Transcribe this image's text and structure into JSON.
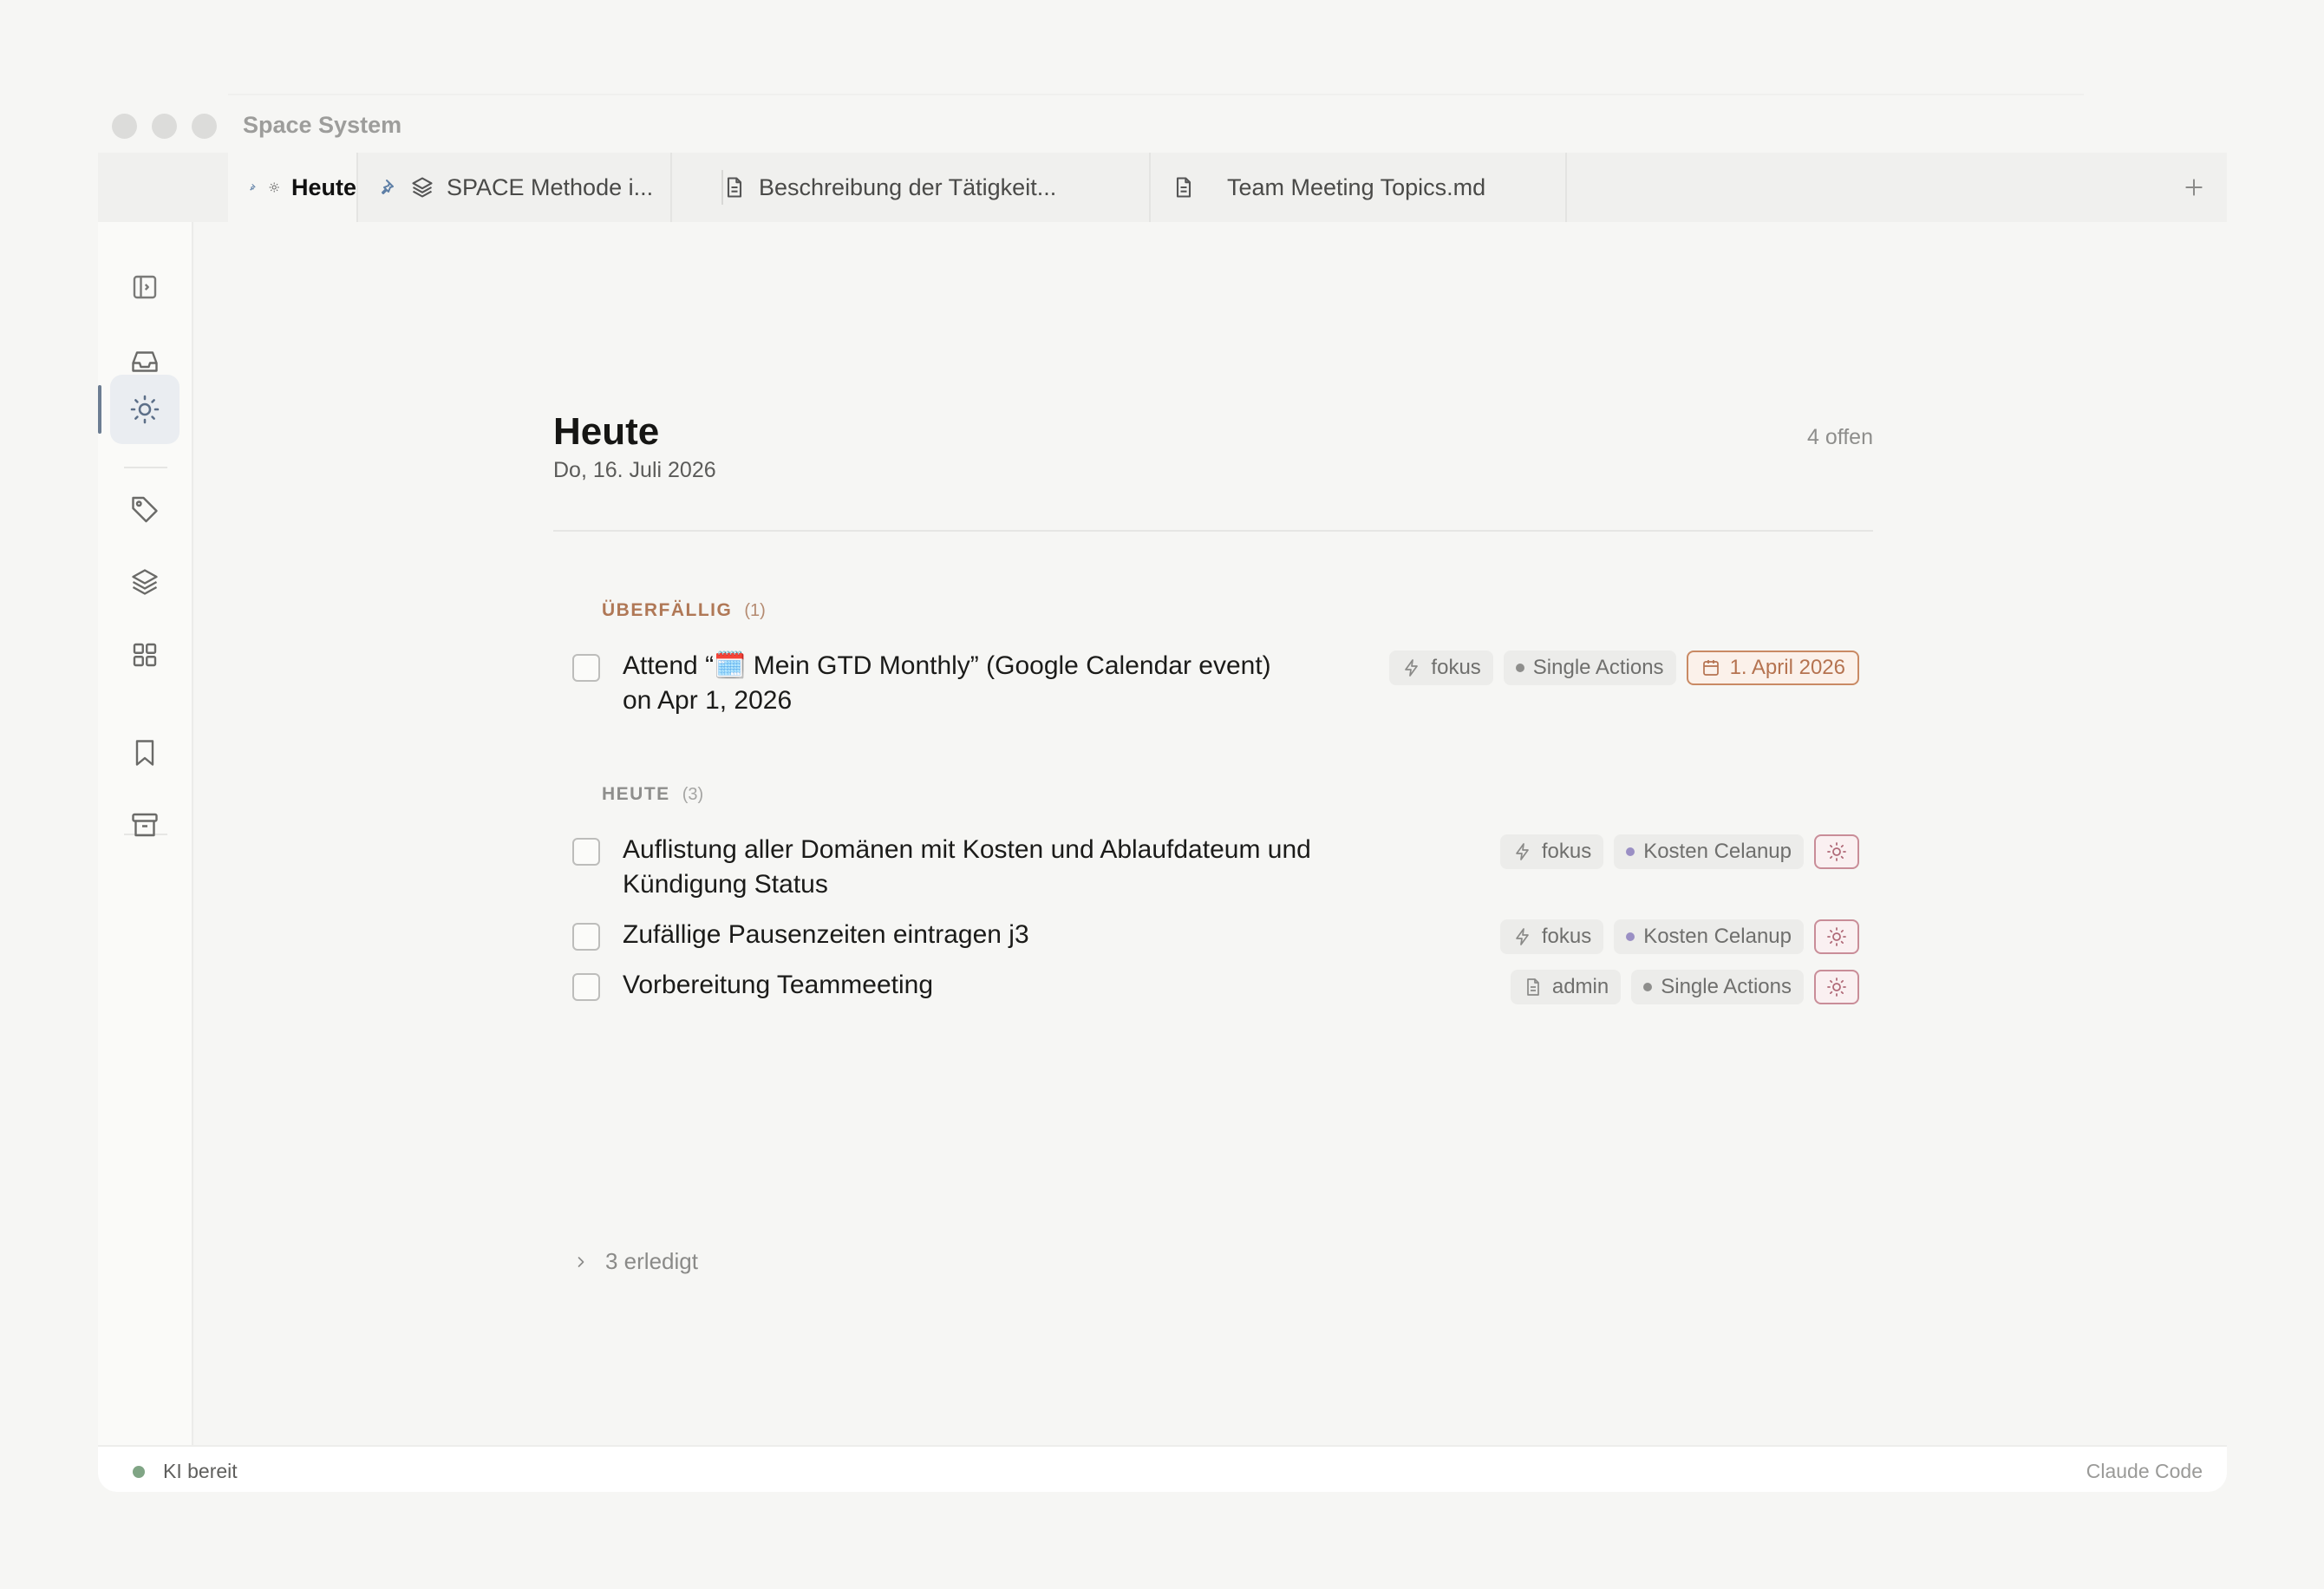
{
  "app": {
    "title": "Space System"
  },
  "tabs": [
    {
      "label": "Heute",
      "pinned": true,
      "icon": "sun-icon",
      "active": true
    },
    {
      "label": "SPACE Methode i...",
      "pinned": true,
      "icon": "layers-icon",
      "active": false
    },
    {
      "label": "Beschreibung der Tätigkeit...",
      "pinned": false,
      "icon": "document-icon",
      "active": false
    },
    {
      "label": "Team Meeting Topics.md",
      "pinned": false,
      "icon": "document-icon",
      "active": false
    }
  ],
  "sidebar": {
    "items": [
      {
        "name": "toggle-sidebar",
        "icon": "sidebar-toggle-icon"
      },
      {
        "name": "inbox",
        "icon": "inbox-icon"
      },
      {
        "name": "today",
        "icon": "sun-icon",
        "active": true
      },
      {
        "name": "tags",
        "icon": "tag-icon"
      },
      {
        "name": "projects",
        "icon": "layers-icon"
      },
      {
        "name": "areas",
        "icon": "grid-icon"
      },
      {
        "name": "bookmarks",
        "icon": "bookmark-icon"
      },
      {
        "name": "archive",
        "icon": "archive-icon"
      }
    ]
  },
  "page": {
    "title": "Heute",
    "date": "Do, 16. Juli 2026",
    "open_count": "4 offen"
  },
  "sections": {
    "overdue": {
      "label": "ÜBERFÄLLIG",
      "count": "(1)",
      "tasks": [
        {
          "line1": "Attend “🗓️ Mein GTD Monthly” (Google Calendar event)",
          "line2": "on Apr 1, 2026",
          "tag1": "fokus",
          "tag2": "Single Actions",
          "due": "1. April 2026"
        }
      ]
    },
    "today": {
      "label": "HEUTE",
      "count": "(3)",
      "tasks": [
        {
          "line1": "Auflistung aller Domänen mit Kosten und Ablaufdateum und",
          "line2": "Kündigung Status",
          "tag1": "fokus",
          "tag2": "Kosten Celanup"
        },
        {
          "line1": "Zufällige Pausenzeiten eintragen j3",
          "tag1": "fokus",
          "tag2": "Kosten Celanup"
        },
        {
          "line1": "Vorbereitung Teammeeting",
          "tag1": "admin",
          "tag2": "Single Actions"
        }
      ]
    }
  },
  "done": {
    "label": "3 erledigt"
  },
  "status": {
    "left": "KI bereit",
    "right": "Claude Code"
  },
  "colors": {
    "accent": "#6c7d92",
    "overdue": "#b07856",
    "project_dot_purple": "#9a8fc4",
    "project_dot_gray": "#8e8e8c",
    "status_ok": "#80a585"
  }
}
